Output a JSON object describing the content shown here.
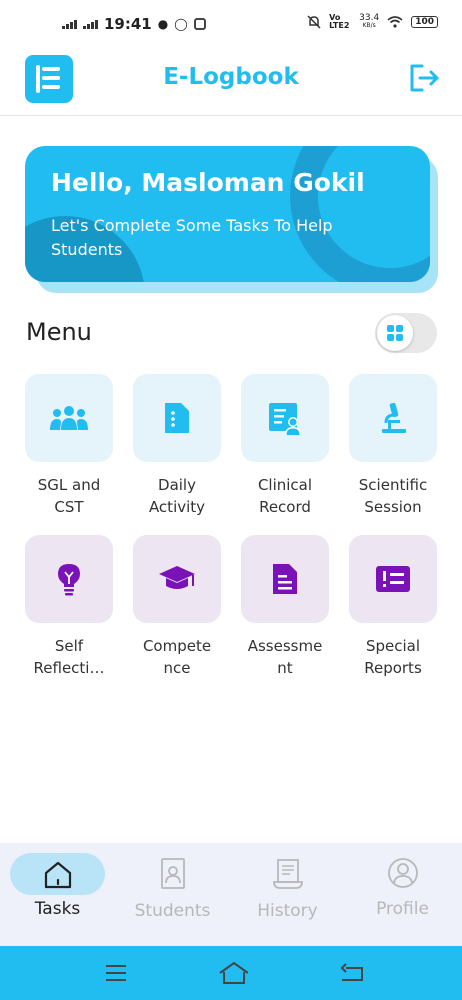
{
  "status_bar": {
    "time": "19:41",
    "lte_label": "Vo LTE2",
    "speed_value": "33.4",
    "speed_unit": "KB/s",
    "battery": "100"
  },
  "header": {
    "title": "E-Logbook",
    "icons": {
      "logo": "logbook-logo",
      "logout": "logout-icon"
    }
  },
  "banner": {
    "greeting": "Hello, Masloman Gokil",
    "subtitle": "Let's Complete Some Tasks To Help Students"
  },
  "menu": {
    "title": "Menu",
    "items": [
      {
        "label": "SGL and\nCST",
        "icon": "group-icon"
      },
      {
        "label": "Daily\nActivity",
        "icon": "document-icon"
      },
      {
        "label": "Clinical\nRecord",
        "icon": "clinical-record-icon"
      },
      {
        "label": "Scientific\nSession",
        "icon": "microscope-icon"
      },
      {
        "label": "Self\nReflecti…",
        "icon": "lightbulb-icon"
      },
      {
        "label": "Compete\nnce",
        "icon": "graduation-cap-icon"
      },
      {
        "label": "Assessme\nnt",
        "icon": "assessment-icon"
      },
      {
        "label": "Special\nReports",
        "icon": "report-icon"
      }
    ]
  },
  "bottom_nav": {
    "tabs": [
      {
        "label": "Tasks",
        "icon": "home-icon",
        "active": true
      },
      {
        "label": "Students",
        "icon": "student-badge-icon",
        "active": false
      },
      {
        "label": "History",
        "icon": "history-scroll-icon",
        "active": false
      },
      {
        "label": "Profile",
        "icon": "profile-icon",
        "active": false
      }
    ]
  },
  "colors": {
    "primary": "#22bdf0",
    "banner_dark": "#1797c6",
    "tile_blue_bg": "#e4f4fa",
    "tile_purple_bg": "#ede5f2",
    "purple_icon": "#7a12b8",
    "nav_bg": "#eef0fa",
    "nav_active_pill": "#b9e3f6"
  }
}
